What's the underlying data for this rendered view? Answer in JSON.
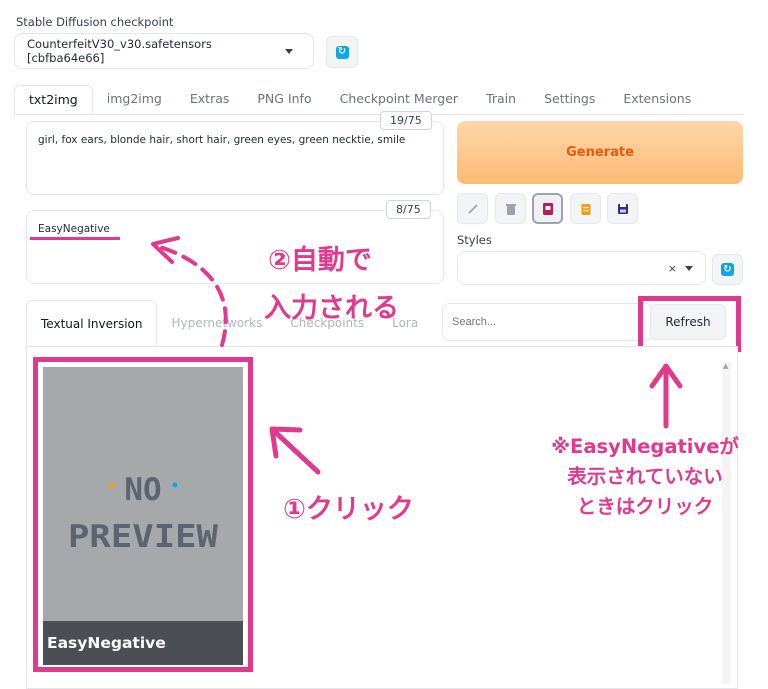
{
  "checkpoint": {
    "label": "Stable Diffusion checkpoint",
    "value": "CounterfeitV30_v30.safetensors [cbfba64e66]"
  },
  "tabs": [
    "txt2img",
    "img2img",
    "Extras",
    "PNG Info",
    "Checkpoint Merger",
    "Train",
    "Settings",
    "Extensions"
  ],
  "prompt": {
    "text": "girl, fox ears, blonde hair, short hair, green eyes, green necktie, smile",
    "counter": "19/75"
  },
  "negative_prompt": {
    "text": "EasyNegative",
    "counter": "8/75"
  },
  "generate_label": "Generate",
  "styles": {
    "label": "Styles",
    "clear_symbol": "×"
  },
  "network_tabs": [
    "Textual Inversion",
    "Hypernetworks",
    "Checkpoints",
    "Lora"
  ],
  "search": {
    "placeholder": "Search..."
  },
  "refresh_label": "Refresh",
  "card": {
    "name": "EasyNegative",
    "preview_line1": "NO",
    "preview_line2": "PREVIEW"
  },
  "annotations": {
    "auto_line1": "②自動で",
    "auto_line2": "入力される",
    "click": "①クリック",
    "note_line1": "※EasyNegativeが",
    "note_line2": "表示されていない",
    "note_line3": "ときはクリック"
  },
  "colors": {
    "annotation": "#e03a8f",
    "generate_text": "#ea580c",
    "generate_bg": "#fdba74",
    "accent_blue": "#0ea5e9"
  }
}
